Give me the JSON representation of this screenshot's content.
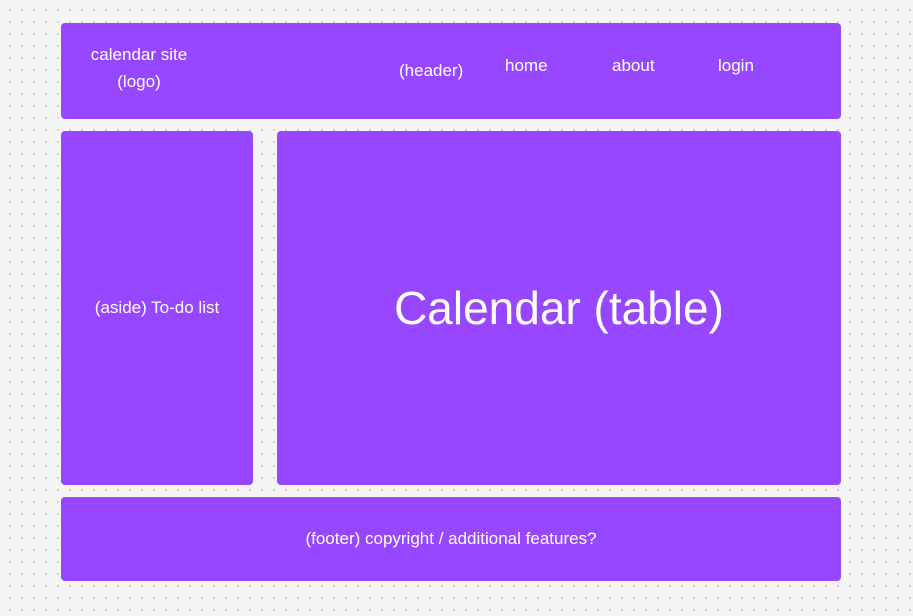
{
  "colors": {
    "block_fill": "#9747ff",
    "text": "#ffffff",
    "canvas": "#f5f5f5"
  },
  "header": {
    "logo_line1": "calendar site",
    "logo_line2": "(logo)",
    "label": "(header)",
    "nav": {
      "home": "home",
      "about": "about",
      "login": "login"
    }
  },
  "aside": {
    "label": "(aside) To-do list"
  },
  "main": {
    "label": "Calendar (table)"
  },
  "footer": {
    "label": "(footer) copyright / additional features?"
  }
}
